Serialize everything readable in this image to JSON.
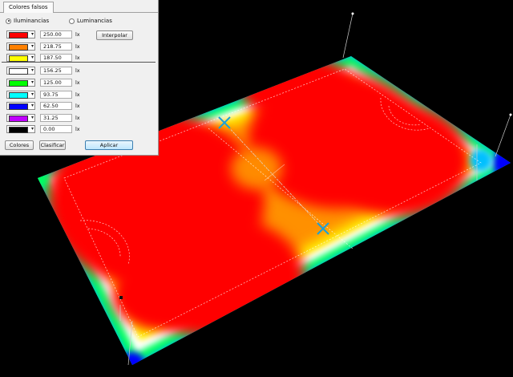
{
  "panel": {
    "tab_label": "Colores falsos",
    "radio_selected_label": "Iluminancias",
    "radio_other_label": "Luminancias",
    "interpolate_label": "Interpolar",
    "unit": "lx",
    "rows": [
      {
        "value": "250.00",
        "color": "#ff0000"
      },
      {
        "value": "218.75",
        "color": "#ff8000"
      },
      {
        "value": "187.50",
        "color": "#ffff00"
      },
      {
        "value": "156.25",
        "color": "#ffffff"
      },
      {
        "value": "125.00",
        "color": "#00ff00"
      },
      {
        "value": "93.75",
        "color": "#00ffff"
      },
      {
        "value": "62.50",
        "color": "#0000ff"
      },
      {
        "value": "31.25",
        "color": "#c000ff"
      },
      {
        "value": "0.00",
        "color": "#000000"
      }
    ],
    "colors_button": "Colores",
    "classify_button": "Clasificar",
    "apply_button": "Aplicar"
  },
  "colors": {
    "background": "#000000",
    "marker": "#1aa0d8"
  }
}
